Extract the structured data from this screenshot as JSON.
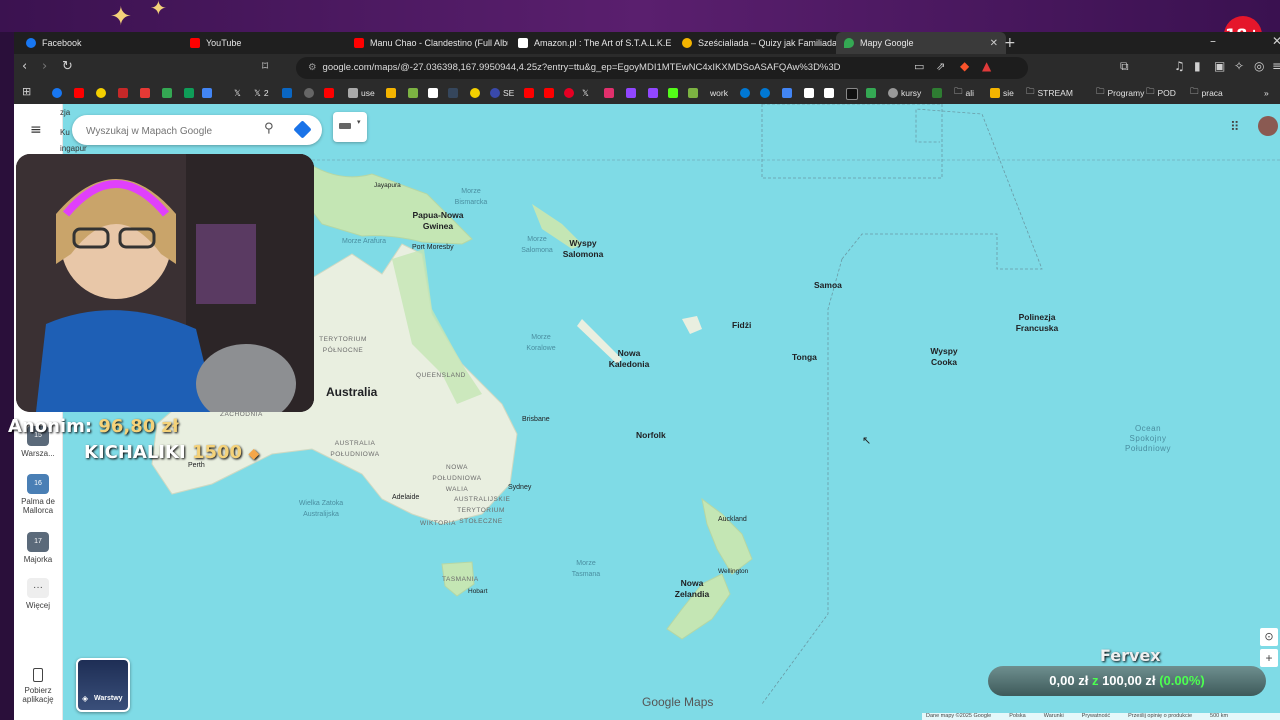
{
  "tabs": [
    {
      "title": "Facebook",
      "color": "#1877f2"
    },
    {
      "title": "YouTube",
      "color": "#ff0000"
    },
    {
      "title": "Manu Chao - Clandestino (Full Album",
      "color": "#ff0000"
    },
    {
      "title": "Amazon.pl : The Art of S.T.A.L.K.E.R. 2",
      "color": "#ffffff"
    },
    {
      "title": "Sześcialiada – Quizy jak Familiada! Gr",
      "color": "#f4b400"
    },
    {
      "title": "Mapy Google",
      "color": "#34a853"
    }
  ],
  "address_url": "google.com/maps/@-27.036398,167.9950944,4.25z?entry=ttu&g_ep=EgoyMDI1MTEwNC4xIKXMDSoASAFQAw%3D%3D",
  "bookmarks": {
    "use": "use",
    "se": "SE",
    "x2": "2",
    "work": "work",
    "kursy": "kursy",
    "ali": "ali",
    "sie": "sie",
    "stream": "STREAM",
    "programy": "Programy",
    "pod": "POD",
    "praca": "praca"
  },
  "badge_18": "18+",
  "maps": {
    "search_placeholder": "Wyszukaj w Mapach Google",
    "rail": {
      "top_label": "zja",
      "top_label2": "Ku",
      "singapur": "ingapur",
      "warsaw": "Warsza...",
      "warsaw_day": "15",
      "palma": "Palma de Mallorca",
      "palma_day": "16",
      "majorka": "Majorka",
      "majorka_day": "17",
      "more": "Więcej",
      "get_app": "Pobierz aplikację"
    },
    "layers_label": "Warstwy",
    "logo": "Google Maps",
    "footer": [
      "Dane mapy ©2025 Google",
      "Polska",
      "Warunki",
      "Prywatność",
      "Prześlij opinię o produkcie",
      "500 km"
    ]
  },
  "map_labels": {
    "jayapura": "Jayapura",
    "morze_bismarcka": "Morze Bismarcka",
    "papua": "Papua-Nowa Gwinea",
    "morze_arafura": "Morze Arafura",
    "port_moresby": "Port Moresby",
    "morze_salomona": "Morze Salomona",
    "wyspy_salomona": "Wyspy Salomona",
    "samoa": "Samoa",
    "polinezja": "Polinezja Francuska",
    "fidzi": "Fidżi",
    "terytorium_polnocne": "TERYTORIUM PÓŁNOCNE",
    "morze_koralowe": "Morze Koralowe",
    "nowa_kaledonia": "Nowa Kaledonia",
    "tonga": "Tonga",
    "wyspy_cooka": "Wyspy Cooka",
    "queensland": "QUEENSLAND",
    "australia": "Australia",
    "brisbane": "Brisbane",
    "australia_zachodnia": "ZACHODNIA",
    "norfolk": "Norfolk",
    "ocean": "Ocean Spokojny Południowy",
    "australia_poludniowa": "AUSTRALIA POŁUDNIOWA",
    "nsw": "NOWA POŁUDNIOWA WALIA",
    "perth": "Perth",
    "sydney": "Sydney",
    "adelaide": "Adelaide",
    "act": "AUSTRALIJSKIE TERYTORIUM STOŁECZNE",
    "wielka_zatoka": "Wielka Zatoka Australijska",
    "wiktoria": "WIKTORIA",
    "auckland": "Auckland",
    "morze_tasmana": "Morze Tasmana",
    "wellington": "Wellington",
    "tasmania": "TASMANIA",
    "nowa_zelandia": "Nowa Zelandia",
    "hobart": "Hobart"
  },
  "overlay": {
    "donor": "Anonim:",
    "donor_amount": "96,80 zł",
    "kichaliki": "KICHALIKI",
    "kichaliki_num": "1500",
    "streamer": "Fervex",
    "goal_current": "0,00 zł",
    "goal_sep": "z",
    "goal_total": "100,00 zł",
    "goal_pct": "(0.00%)"
  },
  "colors": {
    "ocean": "#7fdbe6",
    "land": "#e9efe0",
    "forest": "#c4e6b4",
    "accent_yellow": "#f4d27a",
    "goal_green": "#4cff50"
  }
}
